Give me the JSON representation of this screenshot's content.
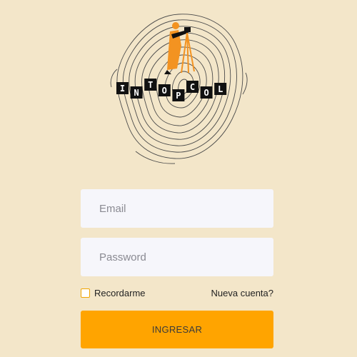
{
  "logo": {
    "letters": [
      "I",
      "N",
      "T",
      "O",
      "P",
      "C",
      "O",
      "L"
    ],
    "colors": {
      "accent": "#f39321",
      "contour": "#4a4a4a",
      "tile": "#111111",
      "tile_text": "#ffffff"
    }
  },
  "form": {
    "email_placeholder": "Email",
    "password_placeholder": "Password",
    "remember_label": "Recordarme",
    "remember_checked": false,
    "new_account_label": "Nueva cuenta?",
    "submit_label": "INGRESAR"
  },
  "colors": {
    "background": "#f3e6c9",
    "field_bg": "#f6f6fb",
    "button": "#ffa400",
    "checkbox_border": "#f0a400"
  }
}
